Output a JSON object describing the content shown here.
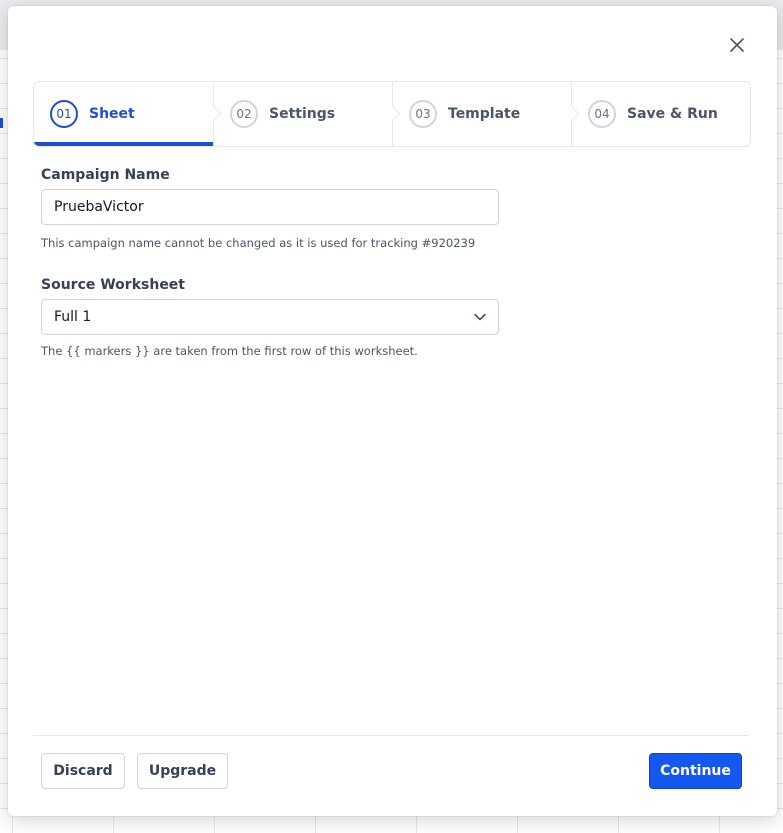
{
  "colors": {
    "accent": "#1d4ed8",
    "primary_button": "#1558f0",
    "border": "#d1d5db",
    "muted_text": "#4b5563"
  },
  "dialog": {
    "close_icon": "close-icon"
  },
  "steps": [
    {
      "number": "01",
      "label": "Sheet",
      "active": true
    },
    {
      "number": "02",
      "label": "Settings",
      "active": false
    },
    {
      "number": "03",
      "label": "Template",
      "active": false
    },
    {
      "number": "04",
      "label": "Save & Run",
      "active": false
    }
  ],
  "campaign": {
    "label": "Campaign Name",
    "value": "PruebaVictor",
    "help": "This campaign name cannot be changed as it is used for tracking #920239"
  },
  "worksheet": {
    "label": "Source Worksheet",
    "selected": "Full 1",
    "help": "The {{ markers }} are taken from the first row of this worksheet.",
    "icon": "chevron-down-icon"
  },
  "footer": {
    "discard_label": "Discard",
    "upgrade_label": "Upgrade",
    "continue_label": "Continue"
  }
}
